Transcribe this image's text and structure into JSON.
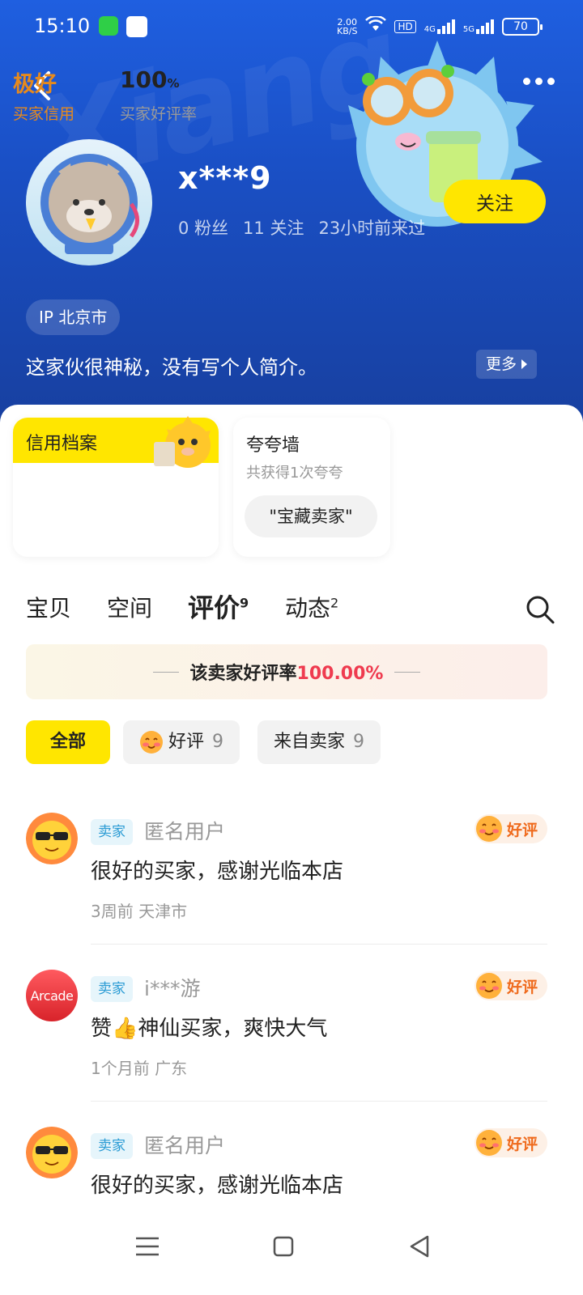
{
  "status_bar": {
    "time": "15:10",
    "net_speed_value": "2.00",
    "net_speed_unit": "KB/S",
    "hd": "HD",
    "net1": "4G",
    "net2": "5G",
    "battery": "70"
  },
  "header": {
    "bg_word": "Xiang",
    "username": "x***9",
    "fans": "0 粉丝",
    "following": "11 关注",
    "last_seen": "23小时前来过",
    "follow_label": "关注",
    "ip_location": "IP 北京市",
    "bio": "这家伙很神秘，没有写个人简介。",
    "more_label": "更多"
  },
  "credit": {
    "title": "信用档案",
    "grade": "极好",
    "grade_label": "买家信用",
    "rate": "100",
    "rate_unit": "%",
    "rate_label": "买家好评率"
  },
  "praise_wall": {
    "title": "夸夸墙",
    "subtitle": "共获得1次夸夸",
    "chip": "\"宝藏卖家\""
  },
  "tabs": [
    {
      "label": "宝贝",
      "count": ""
    },
    {
      "label": "空间",
      "count": ""
    },
    {
      "label": "评价",
      "count": "9"
    },
    {
      "label": "动态",
      "count": "2"
    }
  ],
  "rate_banner": {
    "text": "该卖家好评率",
    "value": "100.00%"
  },
  "filters": [
    {
      "label": "全部",
      "count": ""
    },
    {
      "label": "好评",
      "count": "9"
    },
    {
      "label": "来自卖家",
      "count": "9"
    }
  ],
  "reviews": [
    {
      "tag": "卖家",
      "name": "匿名用户",
      "badge": "好评",
      "content": "很好的买家，感谢光临本店",
      "time": "3周前",
      "location": "天津市"
    },
    {
      "tag": "卖家",
      "name": "i***游",
      "avatar_text": "Arcade",
      "badge": "好评",
      "content": "赞👍神仙买家，爽快大气",
      "time": "1个月前",
      "location": "广东"
    },
    {
      "tag": "卖家",
      "name": "匿名用户",
      "badge": "好评",
      "content": "很好的买家，感谢光临本店",
      "time": "",
      "location": ""
    }
  ],
  "colors": {
    "brand_yellow": "#ffe600",
    "header_blue": "#1a4fc4",
    "accent_orange": "#e78a1c",
    "rate_red": "#ef3b4f"
  }
}
